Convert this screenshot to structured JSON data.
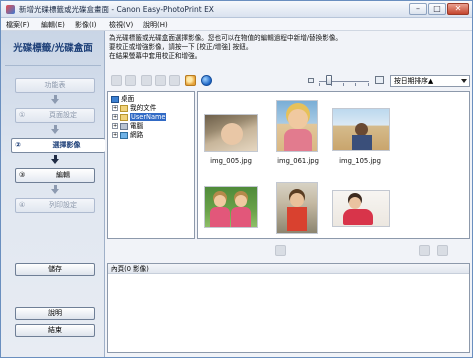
{
  "window": {
    "title": "新增光碟標籤或光碟盒畫面 - Canon Easy-PhotoPrint EX",
    "min_glyph": "–",
    "max_glyph": "□",
    "close_glyph": "✕"
  },
  "menu": [
    "檔案(F)",
    "編輯(E)",
    "影像(I)",
    "檢視(V)",
    "說明(H)"
  ],
  "left_panel": {
    "mode_title": "光碟標籤/光碟盒面",
    "steps": [
      {
        "num": "",
        "label": "功能表"
      },
      {
        "num": "①",
        "label": "頁面設定"
      },
      {
        "num": "②",
        "label": "選擇影像"
      },
      {
        "num": "③",
        "label": "編輯"
      },
      {
        "num": "④",
        "label": "列印設定"
      }
    ],
    "save_label": "儲存",
    "help_label": "說明",
    "exit_label": "結束"
  },
  "instructions": [
    "為光碟標籤或光碟盒面選擇影像。您也可以在物值的編輯過程中新增/替換影像。",
    "要校正或增強影像，請按一下 [校正/增強] 按鈕。",
    "在結果螢幕中套用校正和增強。"
  ],
  "toolbar": {
    "sort_value": "按日期排序▲"
  },
  "zoom": {
    "level": 0.2
  },
  "tree": [
    {
      "expander": "",
      "icon": "desktop-icon",
      "label": "桌面",
      "selected": false
    },
    {
      "expander": "+",
      "icon": "documents-folder-icon",
      "label": "我的文件",
      "selected": false
    },
    {
      "expander": "+",
      "icon": "user-folder-icon",
      "label": "UserName",
      "selected": true
    },
    {
      "expander": "+",
      "icon": "computer-icon",
      "label": "電腦",
      "selected": false
    },
    {
      "expander": "+",
      "icon": "network-icon",
      "label": "網路",
      "selected": false
    }
  ],
  "thumbnails": [
    {
      "caption": "img_005.jpg"
    },
    {
      "caption": "img_061.jpg"
    },
    {
      "caption": "img_105.jpg"
    },
    {
      "caption": ""
    },
    {
      "caption": ""
    },
    {
      "caption": ""
    }
  ],
  "selected_images": {
    "header": "內頁(0 影像)"
  },
  "colors": {
    "accent": "#316ac5",
    "title_blue": "#1d3f78"
  }
}
